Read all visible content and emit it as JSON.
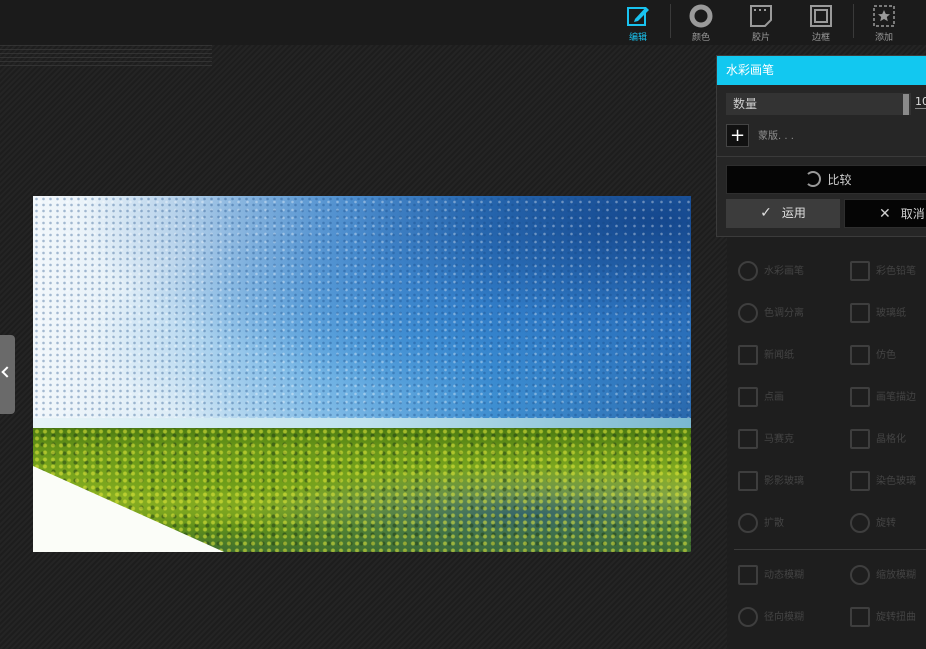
{
  "toolbar": {
    "items": [
      {
        "label": "编辑",
        "icon": "edit-icon",
        "active": true
      },
      {
        "label": "颜色",
        "icon": "color-ring-icon",
        "active": false
      },
      {
        "label": "胶片",
        "icon": "film-icon",
        "active": false
      },
      {
        "label": "边框",
        "icon": "frame-icon",
        "active": false
      },
      {
        "label": "添加",
        "icon": "add-sticker-icon",
        "active": false
      }
    ],
    "accent_color": "#19c3f0"
  },
  "panel": {
    "title": "水彩画笔",
    "amount_label": "数量",
    "amount_value": "10",
    "mask_label": "蒙版. . .",
    "mask_button": "+",
    "compare_label": "比较",
    "apply_label": "运用",
    "cancel_label": "取消",
    "header_color": "#12c8f0"
  },
  "effects": {
    "left": [
      "水彩画笔",
      "色调分离",
      "新闻纸",
      "点画",
      "马赛克",
      "影影玻璃",
      "扩散",
      "动态模糊",
      "径向模糊"
    ],
    "right": [
      "彩色铅笔",
      "玻璃纸",
      "仿色",
      "画笔描边",
      "晶格化",
      "染色玻璃",
      "旋转",
      "缩放模糊",
      "旋转扭曲"
    ]
  }
}
